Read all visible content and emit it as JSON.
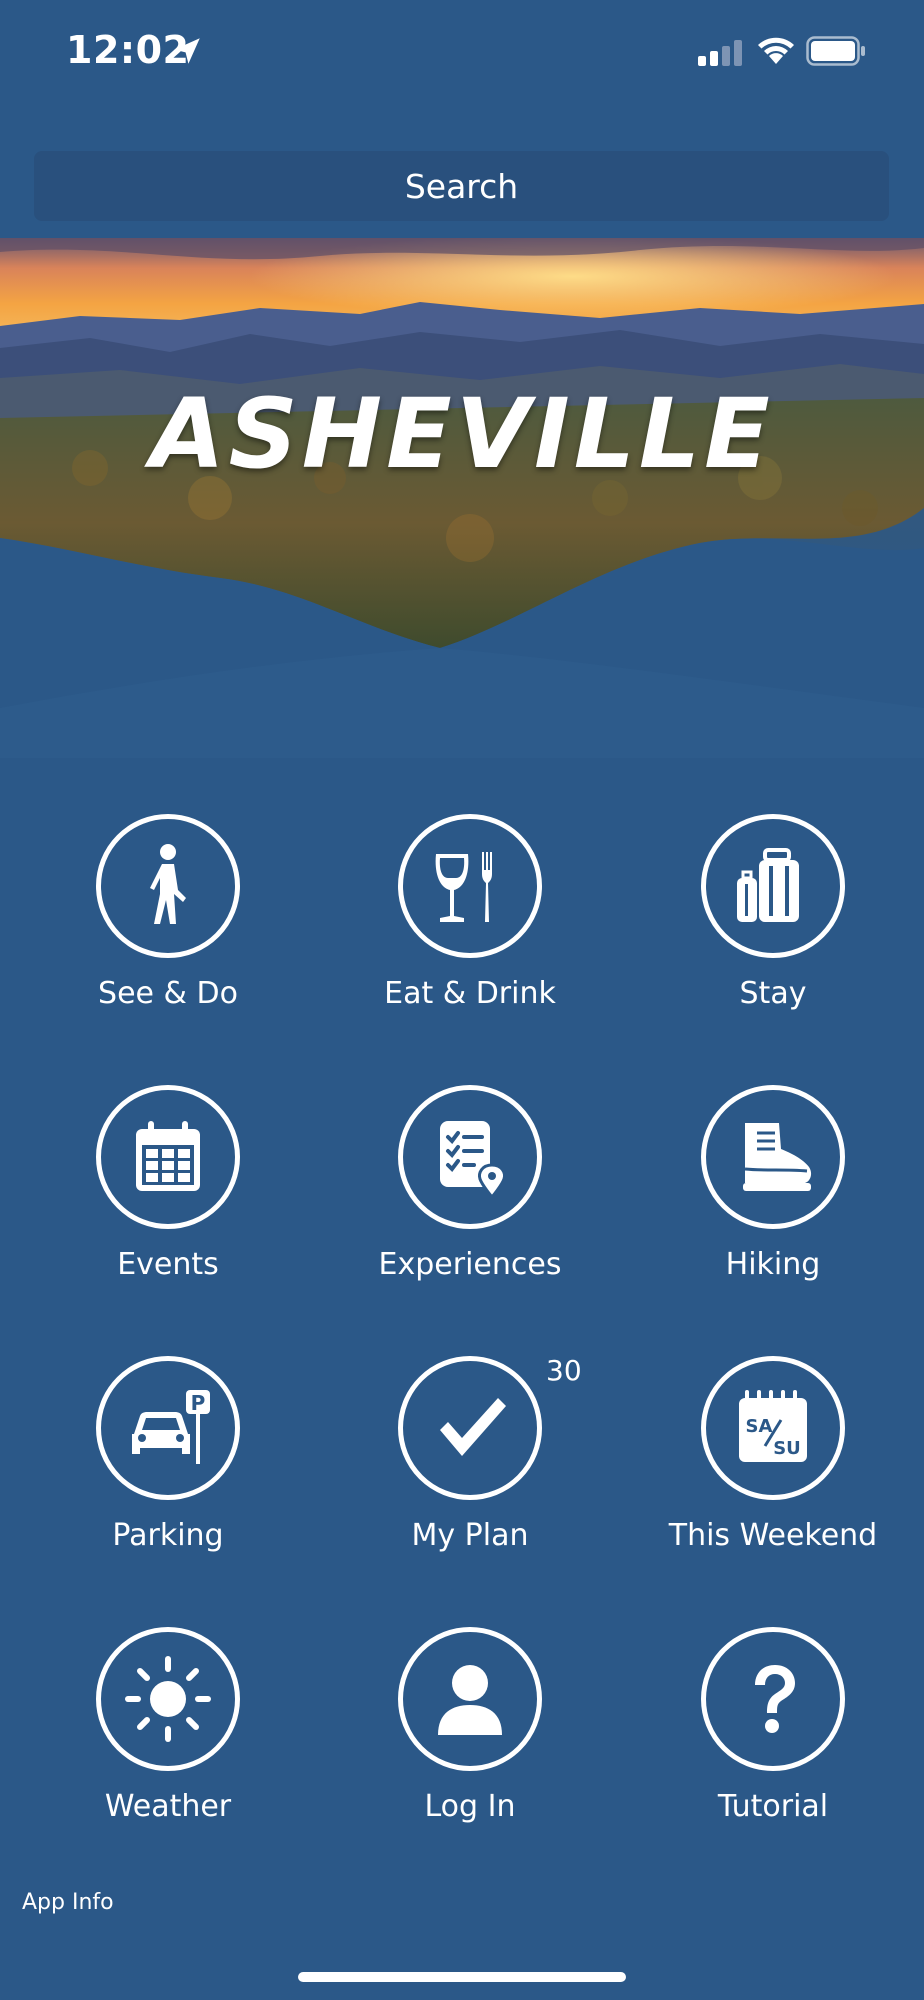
{
  "status_bar": {
    "time": "12:02",
    "icons": [
      "location-arrow-icon",
      "cellular-signal-icon",
      "wifi-icon",
      "battery-icon"
    ]
  },
  "search": {
    "label": "Search"
  },
  "hero": {
    "title": "ASHEVILLE"
  },
  "tiles": [
    {
      "label": "See & Do",
      "icon": "walking-person-icon"
    },
    {
      "label": "Eat & Drink",
      "icon": "wine-fork-icon"
    },
    {
      "label": "Stay",
      "icon": "luggage-icon"
    },
    {
      "label": "Events",
      "icon": "calendar-icon"
    },
    {
      "label": "Experiences",
      "icon": "checklist-pin-icon"
    },
    {
      "label": "Hiking",
      "icon": "hiking-boot-icon"
    },
    {
      "label": "Parking",
      "icon": "car-parking-icon"
    },
    {
      "label": "My Plan",
      "icon": "checkmark-icon",
      "badge": "30"
    },
    {
      "label": "This Weekend",
      "icon": "weekend-calendar-icon",
      "calendar_text_top": "SA",
      "calendar_text_bottom": "SU"
    },
    {
      "label": "Weather",
      "icon": "sun-icon"
    },
    {
      "label": "Log In",
      "icon": "user-icon"
    },
    {
      "label": "Tutorial",
      "icon": "question-mark-icon"
    }
  ],
  "footer": {
    "app_info": "App Info"
  },
  "colors": {
    "background": "#2b5888",
    "search_bg": "#29507d",
    "foreground": "#ffffff"
  }
}
